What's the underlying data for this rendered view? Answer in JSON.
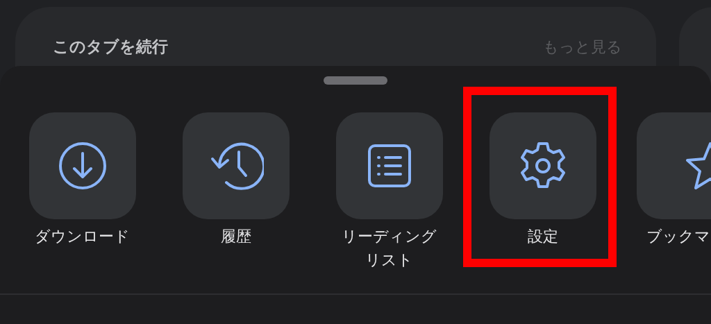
{
  "card": {
    "title": "このタブを続行",
    "more": "もっと見る"
  },
  "items": [
    {
      "kind": "download",
      "label": "ダウンロード",
      "highlighted": false,
      "clipped": false
    },
    {
      "kind": "history",
      "label": "履歴",
      "highlighted": false,
      "clipped": false
    },
    {
      "kind": "reading-list",
      "label": "リーディングリスト",
      "highlighted": false,
      "clipped": false
    },
    {
      "kind": "settings",
      "label": "設定",
      "highlighted": true,
      "clipped": false
    },
    {
      "kind": "bookmark",
      "label": "ブックマ",
      "highlighted": false,
      "clipped": true
    }
  ]
}
